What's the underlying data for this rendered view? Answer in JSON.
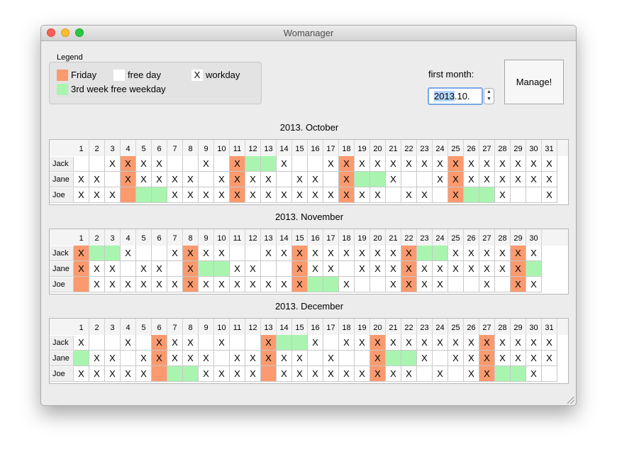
{
  "window": {
    "title": "Womanager"
  },
  "legend": {
    "title": "Legend",
    "items": [
      {
        "swatch": "",
        "color": "#fa9a6e",
        "label": "Friday"
      },
      {
        "swatch": "",
        "color": "#ffffff",
        "label": "free day"
      },
      {
        "swatch": "X",
        "color": "#ffffff",
        "label": "workday"
      },
      {
        "swatch": "",
        "color": "#a9f5b0",
        "label": "3rd week free weekday"
      }
    ]
  },
  "first_month": {
    "label": "first month:",
    "value_selected": "2013",
    "value_rest": ".10."
  },
  "manage_button": {
    "label": "Manage!"
  },
  "colors": {
    "friday": "#fa9a6e",
    "free_weekday": "#a9f5b0",
    "workday": "#ffffff"
  },
  "months": [
    {
      "title": "2013. October",
      "days": [
        "1",
        "2",
        "3",
        "4",
        "5",
        "6",
        "7",
        "8",
        "9",
        "10",
        "11",
        "12",
        "13",
        "14",
        "15",
        "16",
        "17",
        "18",
        "19",
        "20",
        "21",
        "22",
        "23",
        "24",
        "25",
        "26",
        "27",
        "28",
        "29",
        "30",
        "31"
      ],
      "rows": [
        {
          "name": "Jack",
          "cells": [
            "",
            "",
            "X",
            "X",
            "X",
            "X",
            "",
            "",
            "X",
            "",
            "X",
            "",
            "",
            "X",
            "",
            "",
            "X",
            "X",
            "X",
            "X",
            "X",
            "X",
            "X",
            "X",
            "X",
            "X",
            "X",
            "X",
            "X",
            "X",
            "X"
          ]
        },
        {
          "name": "Jane",
          "cells": [
            "X",
            "X",
            "",
            "X",
            "X",
            "X",
            "X",
            "X",
            "",
            "X",
            "X",
            "X",
            "X",
            "",
            "X",
            "X",
            "",
            "X",
            "",
            "",
            "X",
            "",
            "",
            "X",
            "X",
            "X",
            "X",
            "X",
            "X",
            "X",
            "X"
          ]
        },
        {
          "name": "Joe",
          "cells": [
            "X",
            "X",
            "X",
            "",
            "",
            "",
            "X",
            "X",
            "X",
            "X",
            "X",
            "X",
            "X",
            "X",
            "X",
            "X",
            "X",
            "X",
            "X",
            "X",
            "",
            "X",
            "X",
            "",
            "X",
            "",
            "",
            "X",
            "",
            "",
            "X"
          ]
        }
      ],
      "types": [
        [
          "",
          "",
          "",
          "F",
          "",
          "",
          "",
          "",
          "",
          "",
          "F",
          "G",
          "G",
          "",
          "",
          "",
          "",
          "F",
          "",
          "",
          "",
          "",
          "",
          "",
          "F",
          "",
          "",
          "",
          "",
          "",
          ""
        ],
        [
          "",
          "",
          "",
          "F",
          "",
          "",
          "",
          "",
          "",
          "",
          "F",
          "",
          "",
          "",
          "",
          "",
          "",
          "F",
          "G",
          "G",
          "",
          "",
          "",
          "",
          "F",
          "",
          "",
          "",
          "",
          "",
          ""
        ],
        [
          "",
          "",
          "",
          "F",
          "G",
          "G",
          "",
          "",
          "",
          "",
          "F",
          "",
          "",
          "",
          "",
          "",
          "",
          "F",
          "",
          "",
          "",
          "",
          "",
          "",
          "F",
          "G",
          "G",
          "",
          "",
          "",
          ""
        ]
      ]
    },
    {
      "title": "2013. November",
      "days": [
        "1",
        "2",
        "3",
        "4",
        "5",
        "6",
        "7",
        "8",
        "9",
        "10",
        "11",
        "12",
        "13",
        "14",
        "15",
        "16",
        "17",
        "18",
        "19",
        "20",
        "21",
        "22",
        "23",
        "24",
        "25",
        "26",
        "27",
        "28",
        "29",
        "30"
      ],
      "rows": [
        {
          "name": "Jack",
          "cells": [
            "X",
            "",
            "",
            "X",
            "",
            "",
            "X",
            "X",
            "X",
            "X",
            "",
            "",
            "X",
            "X",
            "X",
            "X",
            "X",
            "X",
            "X",
            "X",
            "X",
            "X",
            "",
            "",
            "X",
            "X",
            "X",
            "X",
            "X",
            "X"
          ]
        },
        {
          "name": "Jane",
          "cells": [
            "X",
            "X",
            "X",
            "",
            "X",
            "X",
            "",
            "X",
            "",
            "",
            "X",
            "X",
            "",
            "",
            "X",
            "X",
            "X",
            "",
            "X",
            "X",
            "X",
            "X",
            "X",
            "X",
            "X",
            "X",
            "X",
            "X",
            "X",
            ""
          ]
        },
        {
          "name": "Joe",
          "cells": [
            "",
            "X",
            "X",
            "X",
            "X",
            "X",
            "X",
            "X",
            "X",
            "X",
            "X",
            "X",
            "X",
            "X",
            "X",
            "",
            "",
            "X",
            "",
            "",
            "X",
            "X",
            "X",
            "X",
            "",
            "",
            "X",
            "",
            "X",
            "X"
          ]
        }
      ],
      "types": [
        [
          "F",
          "G",
          "G",
          "",
          "",
          "",
          "",
          "F",
          "",
          "",
          "",
          "",
          "",
          "",
          "F",
          "",
          "",
          "",
          "",
          "",
          "",
          "F",
          "G",
          "G",
          "",
          "",
          "",
          "",
          "F",
          ""
        ],
        [
          "F",
          "",
          "",
          "",
          "",
          "",
          "",
          "F",
          "G",
          "G",
          "",
          "",
          "",
          "",
          "F",
          "",
          "",
          "",
          "",
          "",
          "",
          "F",
          "",
          "",
          "",
          "",
          "",
          "",
          "F",
          "G"
        ],
        [
          "F",
          "",
          "",
          "",
          "",
          "",
          "",
          "F",
          "",
          "",
          "",
          "",
          "",
          "",
          "F",
          "G",
          "G",
          "",
          "",
          "",
          "",
          "F",
          "",
          "",
          "",
          "",
          "",
          "",
          "F",
          ""
        ]
      ]
    },
    {
      "title": "2013. December",
      "days": [
        "1",
        "2",
        "3",
        "4",
        "5",
        "6",
        "7",
        "8",
        "9",
        "10",
        "11",
        "12",
        "13",
        "14",
        "15",
        "16",
        "17",
        "18",
        "19",
        "20",
        "21",
        "22",
        "23",
        "24",
        "25",
        "26",
        "27",
        "28",
        "29",
        "30",
        "31"
      ],
      "rows": [
        {
          "name": "Jack",
          "cells": [
            "X",
            "",
            "",
            "X",
            "",
            "X",
            "X",
            "X",
            "",
            "X",
            "",
            "",
            "X",
            "",
            "",
            "X",
            "",
            "X",
            "X",
            "X",
            "X",
            "X",
            "X",
            "X",
            "X",
            "X",
            "X",
            "X",
            "X",
            "X",
            "X"
          ]
        },
        {
          "name": "Jane",
          "cells": [
            "",
            "X",
            "X",
            "",
            "X",
            "X",
            "X",
            "X",
            "X",
            "",
            "X",
            "X",
            "X",
            "X",
            "X",
            "",
            "X",
            "",
            "",
            "X",
            "",
            "",
            "X",
            "",
            "X",
            "X",
            "X",
            "X",
            "X",
            "X",
            "X"
          ]
        },
        {
          "name": "Joe",
          "cells": [
            "X",
            "X",
            "X",
            "X",
            "X",
            "",
            "",
            "",
            "X",
            "X",
            "X",
            "X",
            "",
            "X",
            "X",
            "X",
            "X",
            "X",
            "X",
            "X",
            "X",
            "X",
            "",
            "X",
            "",
            "X",
            "X",
            "",
            "",
            "X",
            ""
          ]
        }
      ],
      "types": [
        [
          "",
          "",
          "",
          "",
          "",
          "F",
          "",
          "",
          "",
          "",
          "",
          "",
          "F",
          "G",
          "G",
          "",
          "",
          "",
          "",
          "F",
          "",
          "",
          "",
          "",
          "",
          "",
          "F",
          "",
          "",
          "",
          ""
        ],
        [
          "G",
          "",
          "",
          "",
          "",
          "F",
          "",
          "",
          "",
          "",
          "",
          "",
          "F",
          "",
          "",
          "",
          "",
          "",
          "",
          "F",
          "G",
          "G",
          "",
          "",
          "",
          "",
          "F",
          "",
          "",
          "",
          ""
        ],
        [
          "",
          "",
          "",
          "",
          "",
          "F",
          "G",
          "G",
          "",
          "",
          "",
          "",
          "F",
          "",
          "",
          "",
          "",
          "",
          "",
          "F",
          "",
          "",
          "",
          "",
          "",
          "",
          "F",
          "G",
          "G",
          "",
          ""
        ]
      ]
    }
  ]
}
